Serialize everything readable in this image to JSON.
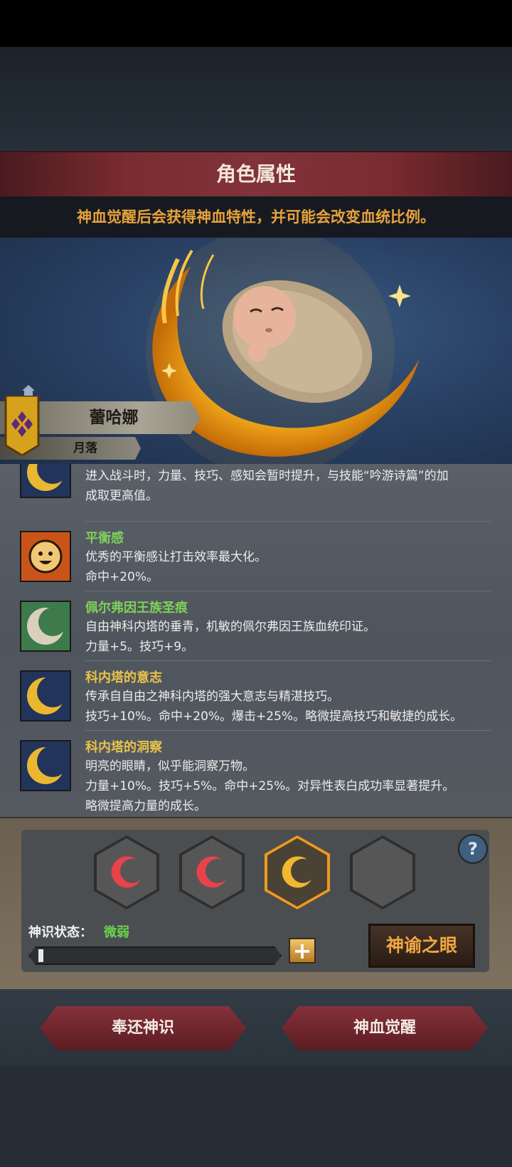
{
  "header": {
    "title": "角色属性"
  },
  "notice": "神血觉醒后会获得神血特性，并可能会改变血统比例。",
  "character": {
    "name": "蕾哈娜",
    "title": "月落"
  },
  "traits": [
    {
      "name": "",
      "lines": [
        "进入战斗时，力量、技巧、感知会暂时提升，与技能“吟游诗篇”的加",
        "成取更高值。"
      ],
      "icon": "crescent-moon-icon"
    },
    {
      "name": "平衡感",
      "lines": [
        "优秀的平衡感让打击效率最大化。",
        "命中+20%。"
      ],
      "icon": "smiling-sun-icon"
    },
    {
      "name": "佩尔弗因王族圣痕",
      "lines": [
        "自由神科内塔的垂青，机敏的佩尔弗因王族血统印证。",
        "力量+5。技巧+9。"
      ],
      "icon": "green-moon-icon"
    },
    {
      "name": "科内塔的意志",
      "lines": [
        "传承自自由之神科内塔的强大意志与精湛技巧。",
        "技巧+10%。命中+20%。爆击+25%。略微提高技巧和敏捷的成长。"
      ],
      "icon": "crescent-moon-icon"
    },
    {
      "name": "科内塔的洞察",
      "lines": [
        "明亮的眼睛，似乎能洞察万物。",
        "力量+10%。技巧+5%。命中+25%。对异性表白成功率显著提升。",
        "略微提高力量的成长。"
      ],
      "icon": "crescent-moon-icon"
    }
  ],
  "colors": {
    "trait_name_green": "#7fd05a",
    "trait_name_gold": "#e8c34a",
    "accent_orange": "#e8a23c"
  },
  "slots": [
    {
      "state": "red"
    },
    {
      "state": "red"
    },
    {
      "state": "gold-selected"
    },
    {
      "state": "empty"
    }
  ],
  "status": {
    "label": "神识状态：",
    "value": "微弱",
    "progress": 0.02
  },
  "buttons": {
    "oracle": "神谕之眼",
    "return": "奉还神识",
    "awaken": "神血觉醒",
    "help": "?",
    "plus": "+"
  }
}
